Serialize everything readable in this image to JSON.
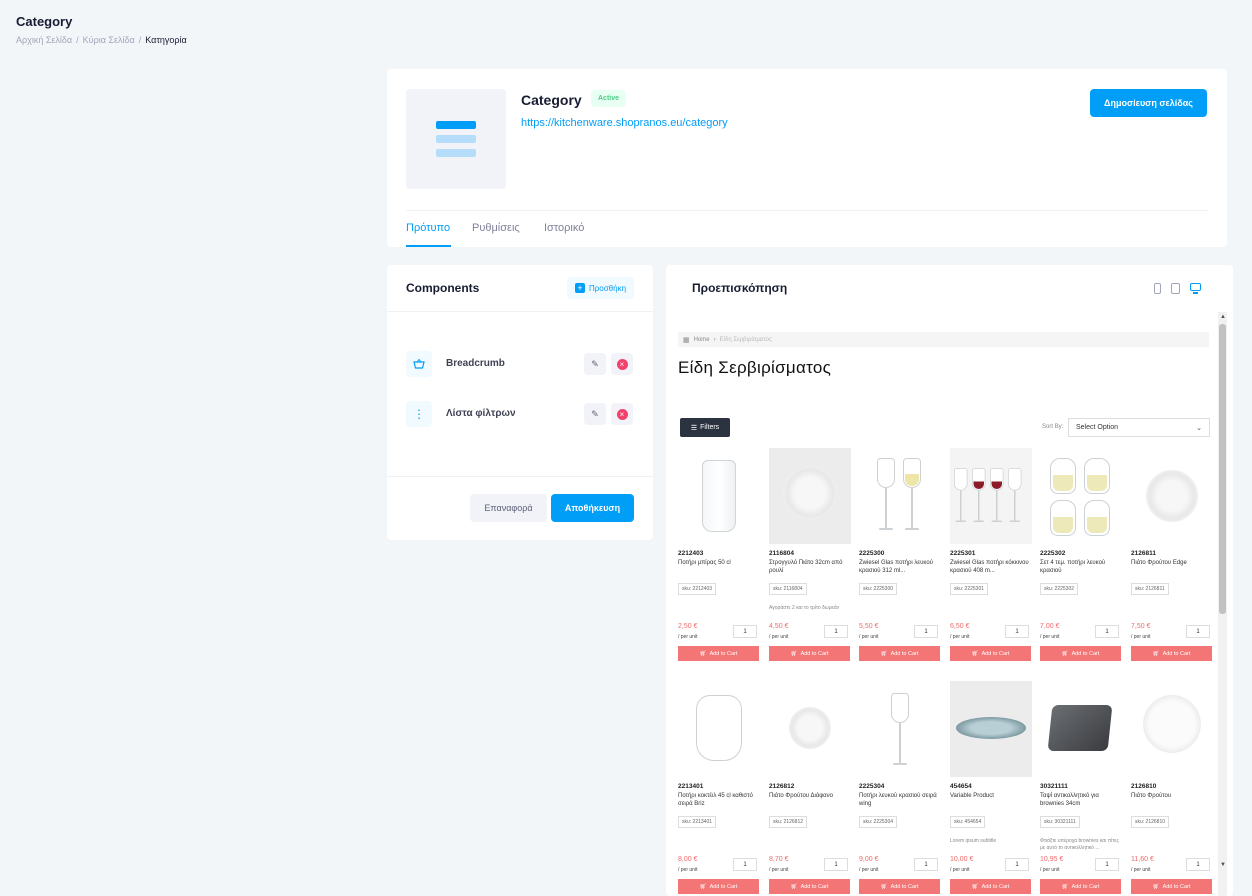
{
  "page": {
    "title": "Category",
    "breadcrumb": [
      "Αρχική Σελίδα",
      "Κύρια Σελίδα",
      "Κατηγορία"
    ]
  },
  "category": {
    "name": "Category",
    "status": "Active",
    "url": "https://kitchenware.shopranos.eu/category",
    "publish_label": "Δημοσίευση σελίδας",
    "tabs": [
      "Πρότυπο",
      "Ρυθμίσεις",
      "Ιστορικό"
    ],
    "active_tab": "Πρότυπο"
  },
  "components": {
    "title": "Components",
    "add_label": "Προσθήκη",
    "items": [
      {
        "label": "Breadcrumb",
        "icon": "basket-icon"
      },
      {
        "label": "Λίστα φίλτρων",
        "icon": "vertical-dots-icon"
      }
    ],
    "reset_label": "Επαναφορά",
    "save_label": "Αποθήκευση"
  },
  "preview": {
    "title": "Προεπισκόπηση",
    "devices": [
      "mobile",
      "tablet",
      "desktop"
    ],
    "active_device": "desktop",
    "site": {
      "breadcrumb": [
        "Home",
        "Είδη Σερβιρίσματος"
      ],
      "heading": "Είδη Σερβιρίσματος",
      "filters_label": "Filters",
      "sort_label": "Sort By:",
      "sort_value": "Select Option",
      "add_to_cart": "Add to Cart",
      "per_unit": "/ per unit",
      "products": [
        {
          "code": "2212403",
          "name": "Ποτήρι μπίρας 50 cl",
          "sku": "sku: 2212403",
          "price": "2,50 €",
          "qty": "1",
          "note": "",
          "image": "pint-glass"
        },
        {
          "code": "2116804",
          "name": "Στρογγυλό Πιάτο 32cm από ρουλί",
          "sku": "sku: 2116804",
          "price": "4,50 €",
          "qty": "1",
          "note": "Αγοράστε 2 και το τρίτο δωρεάν",
          "image": "plate-grey"
        },
        {
          "code": "2225300",
          "name": "Zwiesel Glas ποτήρι λευκού κρασιού 312 ml...",
          "sku": "sku: 2225300",
          "price": "5,50 €",
          "qty": "1",
          "note": "",
          "image": "wine-glasses"
        },
        {
          "code": "2225301",
          "name": "Zwiesel Glas ποτήρι κόκκινου κρασιού 408 m...",
          "sku": "sku: 2225301",
          "price": "6,50 €",
          "qty": "1",
          "note": "",
          "image": "wine-set"
        },
        {
          "code": "2225302",
          "name": "Σετ 4 τεμ. ποτήρι λευκού κρασιού",
          "sku": "sku: 2225302",
          "price": "7,00 €",
          "qty": "1",
          "note": "",
          "image": "tumbler-set"
        },
        {
          "code": "2126811",
          "name": "Πιάτο Φρούτου Edge",
          "sku": "sku: 2126811",
          "price": "7,50 €",
          "qty": "1",
          "note": "",
          "image": "plate-white"
        },
        {
          "code": "2213401",
          "name": "Ποτήρι κοκτέιλ 45 cl καθιστό σειρά Briz",
          "sku": "sku: 2213401",
          "price": "8,00 €",
          "qty": "1",
          "note": "",
          "image": "cocktail-glass"
        },
        {
          "code": "2126812",
          "name": "Πιάτο Φρούτου Διάφανο",
          "sku": "sku: 2126812",
          "price": "8,70 €",
          "qty": "1",
          "note": "",
          "image": "plate-clear"
        },
        {
          "code": "2225304",
          "name": "Ποτήρι λευκού κρασιού σειρά wing",
          "sku": "sku: 2225304",
          "price": "9,00 €",
          "qty": "1",
          "note": "",
          "image": "wine-single"
        },
        {
          "code": "454654",
          "name": "Variable Product",
          "sku": "sku: 454654",
          "price": "10,00 €",
          "qty": "1",
          "note": "Lorem ipsum subtitle",
          "image": "plate-blue"
        },
        {
          "code": "30321111",
          "name": "Ταψί αντικολλητικό για brownies 34cm",
          "sku": "sku: 30321111",
          "price": "10,95 €",
          "qty": "1",
          "note": "Φτιάξτε υπέροχα brownies και πίτες με αυτό το αντικολλητικό ...",
          "image": "baking-tray"
        },
        {
          "code": "2126810",
          "name": "Πιάτο Φρούτου",
          "sku": "sku: 2126810",
          "price": "11,60 €",
          "qty": "1",
          "note": "",
          "image": "plate-glass"
        }
      ]
    }
  },
  "colors": {
    "primary": "#009ef7",
    "success": "#50cd89",
    "danger": "#f1416c",
    "cart": "#f37576",
    "price": "#ef6b6b"
  }
}
